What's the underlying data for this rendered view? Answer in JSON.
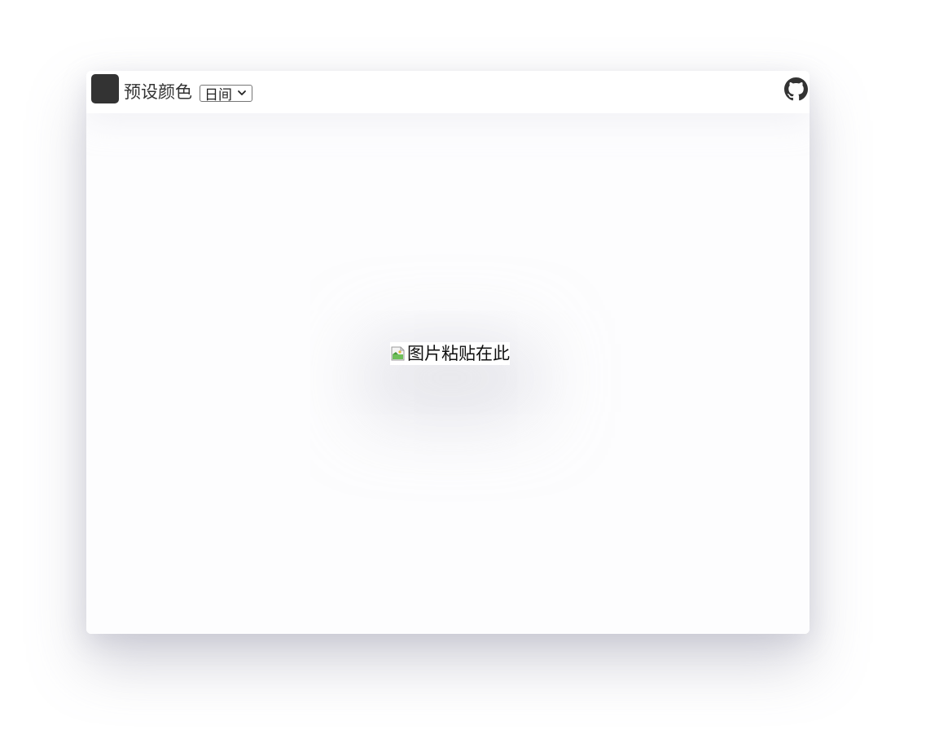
{
  "toolbar": {
    "preset_color_label": "预设颜色",
    "swatch_color": "#333333",
    "mode_select": {
      "selected": "日间"
    },
    "github_icon": "github-icon"
  },
  "canvas": {
    "paste_alt_text": "图片粘贴在此",
    "image_icon": "broken-image-icon"
  }
}
